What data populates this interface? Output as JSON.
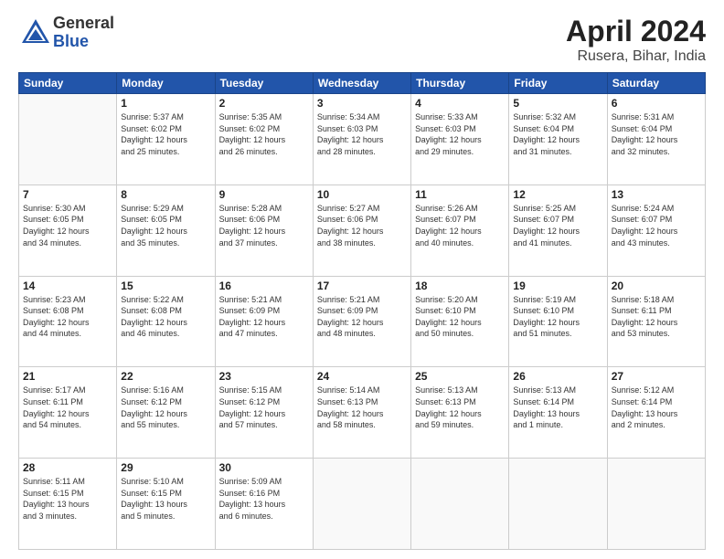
{
  "logo": {
    "general": "General",
    "blue": "Blue"
  },
  "title": {
    "month": "April 2024",
    "location": "Rusera, Bihar, India"
  },
  "weekdays": [
    "Sunday",
    "Monday",
    "Tuesday",
    "Wednesday",
    "Thursday",
    "Friday",
    "Saturday"
  ],
  "weeks": [
    [
      {
        "day": "",
        "info": ""
      },
      {
        "day": "1",
        "info": "Sunrise: 5:37 AM\nSunset: 6:02 PM\nDaylight: 12 hours\nand 25 minutes."
      },
      {
        "day": "2",
        "info": "Sunrise: 5:35 AM\nSunset: 6:02 PM\nDaylight: 12 hours\nand 26 minutes."
      },
      {
        "day": "3",
        "info": "Sunrise: 5:34 AM\nSunset: 6:03 PM\nDaylight: 12 hours\nand 28 minutes."
      },
      {
        "day": "4",
        "info": "Sunrise: 5:33 AM\nSunset: 6:03 PM\nDaylight: 12 hours\nand 29 minutes."
      },
      {
        "day": "5",
        "info": "Sunrise: 5:32 AM\nSunset: 6:04 PM\nDaylight: 12 hours\nand 31 minutes."
      },
      {
        "day": "6",
        "info": "Sunrise: 5:31 AM\nSunset: 6:04 PM\nDaylight: 12 hours\nand 32 minutes."
      }
    ],
    [
      {
        "day": "7",
        "info": "Sunrise: 5:30 AM\nSunset: 6:05 PM\nDaylight: 12 hours\nand 34 minutes."
      },
      {
        "day": "8",
        "info": "Sunrise: 5:29 AM\nSunset: 6:05 PM\nDaylight: 12 hours\nand 35 minutes."
      },
      {
        "day": "9",
        "info": "Sunrise: 5:28 AM\nSunset: 6:06 PM\nDaylight: 12 hours\nand 37 minutes."
      },
      {
        "day": "10",
        "info": "Sunrise: 5:27 AM\nSunset: 6:06 PM\nDaylight: 12 hours\nand 38 minutes."
      },
      {
        "day": "11",
        "info": "Sunrise: 5:26 AM\nSunset: 6:07 PM\nDaylight: 12 hours\nand 40 minutes."
      },
      {
        "day": "12",
        "info": "Sunrise: 5:25 AM\nSunset: 6:07 PM\nDaylight: 12 hours\nand 41 minutes."
      },
      {
        "day": "13",
        "info": "Sunrise: 5:24 AM\nSunset: 6:07 PM\nDaylight: 12 hours\nand 43 minutes."
      }
    ],
    [
      {
        "day": "14",
        "info": "Sunrise: 5:23 AM\nSunset: 6:08 PM\nDaylight: 12 hours\nand 44 minutes."
      },
      {
        "day": "15",
        "info": "Sunrise: 5:22 AM\nSunset: 6:08 PM\nDaylight: 12 hours\nand 46 minutes."
      },
      {
        "day": "16",
        "info": "Sunrise: 5:21 AM\nSunset: 6:09 PM\nDaylight: 12 hours\nand 47 minutes."
      },
      {
        "day": "17",
        "info": "Sunrise: 5:21 AM\nSunset: 6:09 PM\nDaylight: 12 hours\nand 48 minutes."
      },
      {
        "day": "18",
        "info": "Sunrise: 5:20 AM\nSunset: 6:10 PM\nDaylight: 12 hours\nand 50 minutes."
      },
      {
        "day": "19",
        "info": "Sunrise: 5:19 AM\nSunset: 6:10 PM\nDaylight: 12 hours\nand 51 minutes."
      },
      {
        "day": "20",
        "info": "Sunrise: 5:18 AM\nSunset: 6:11 PM\nDaylight: 12 hours\nand 53 minutes."
      }
    ],
    [
      {
        "day": "21",
        "info": "Sunrise: 5:17 AM\nSunset: 6:11 PM\nDaylight: 12 hours\nand 54 minutes."
      },
      {
        "day": "22",
        "info": "Sunrise: 5:16 AM\nSunset: 6:12 PM\nDaylight: 12 hours\nand 55 minutes."
      },
      {
        "day": "23",
        "info": "Sunrise: 5:15 AM\nSunset: 6:12 PM\nDaylight: 12 hours\nand 57 minutes."
      },
      {
        "day": "24",
        "info": "Sunrise: 5:14 AM\nSunset: 6:13 PM\nDaylight: 12 hours\nand 58 minutes."
      },
      {
        "day": "25",
        "info": "Sunrise: 5:13 AM\nSunset: 6:13 PM\nDaylight: 12 hours\nand 59 minutes."
      },
      {
        "day": "26",
        "info": "Sunrise: 5:13 AM\nSunset: 6:14 PM\nDaylight: 13 hours\nand 1 minute."
      },
      {
        "day": "27",
        "info": "Sunrise: 5:12 AM\nSunset: 6:14 PM\nDaylight: 13 hours\nand 2 minutes."
      }
    ],
    [
      {
        "day": "28",
        "info": "Sunrise: 5:11 AM\nSunset: 6:15 PM\nDaylight: 13 hours\nand 3 minutes."
      },
      {
        "day": "29",
        "info": "Sunrise: 5:10 AM\nSunset: 6:15 PM\nDaylight: 13 hours\nand 5 minutes."
      },
      {
        "day": "30",
        "info": "Sunrise: 5:09 AM\nSunset: 6:16 PM\nDaylight: 13 hours\nand 6 minutes."
      },
      {
        "day": "",
        "info": ""
      },
      {
        "day": "",
        "info": ""
      },
      {
        "day": "",
        "info": ""
      },
      {
        "day": "",
        "info": ""
      }
    ]
  ]
}
